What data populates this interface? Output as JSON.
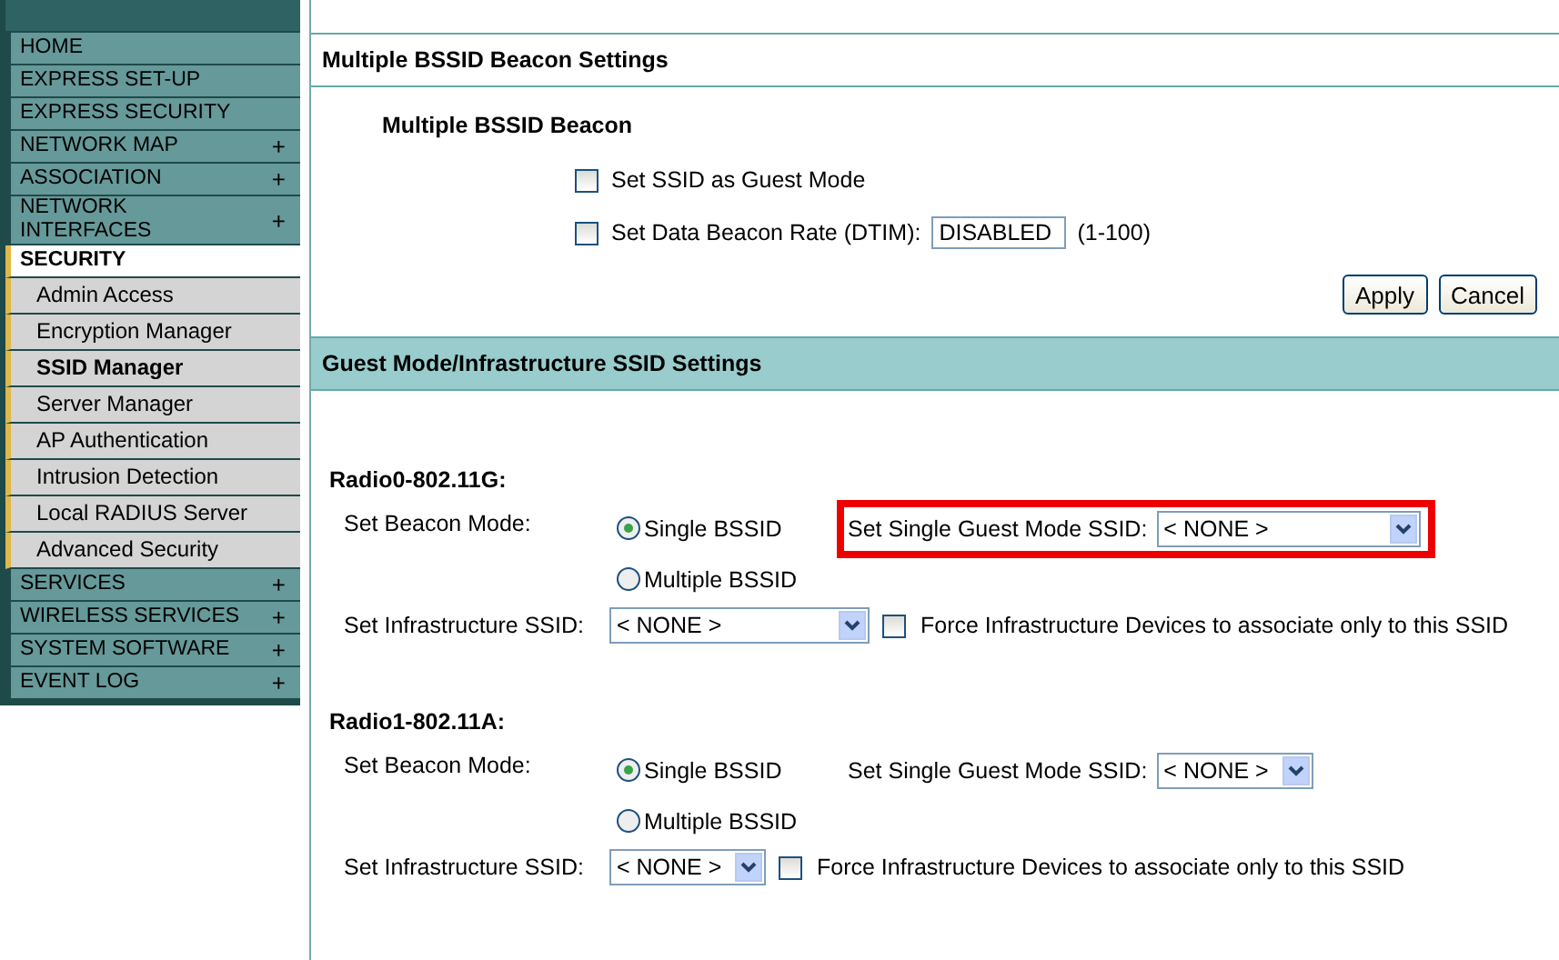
{
  "sidebar": {
    "items": [
      {
        "label": "HOME",
        "kind": "top",
        "selected": false
      },
      {
        "label": "EXPRESS SET-UP",
        "kind": "top",
        "selected": false
      },
      {
        "label": "EXPRESS SECURITY",
        "kind": "top",
        "selected": false
      },
      {
        "label": "NETWORK MAP",
        "kind": "top",
        "expand_glyph": "+",
        "selected": false
      },
      {
        "label": "ASSOCIATION",
        "kind": "top",
        "expand_glyph": "+",
        "selected": false
      },
      {
        "label": "NETWORK INTERFACES",
        "kind": "top",
        "expand_glyph": "+",
        "selected": false
      },
      {
        "label": "SECURITY",
        "kind": "top",
        "selected": true
      },
      {
        "label": "Admin Access",
        "kind": "sub",
        "selected": false
      },
      {
        "label": "Encryption Manager",
        "kind": "sub",
        "selected": false
      },
      {
        "label": "SSID Manager",
        "kind": "sub",
        "selected": true
      },
      {
        "label": "Server Manager",
        "kind": "sub",
        "selected": false
      },
      {
        "label": "AP Authentication",
        "kind": "sub",
        "selected": false
      },
      {
        "label": "Intrusion Detection",
        "kind": "sub",
        "selected": false
      },
      {
        "label": "Local RADIUS Server",
        "kind": "sub",
        "selected": false
      },
      {
        "label": "Advanced Security",
        "kind": "sub",
        "selected": false
      },
      {
        "label": "SERVICES",
        "kind": "top",
        "expand_glyph": "+",
        "selected": false
      },
      {
        "label": "WIRELESS SERVICES",
        "kind": "top",
        "expand_glyph": "+",
        "selected": false
      },
      {
        "label": "SYSTEM SOFTWARE",
        "kind": "top",
        "expand_glyph": "+",
        "selected": false
      },
      {
        "label": "EVENT LOG",
        "kind": "top",
        "expand_glyph": "+",
        "selected": false
      }
    ]
  },
  "beacon_section": {
    "title": "Multiple BSSID Beacon Settings",
    "subtitle": "Multiple BSSID Beacon",
    "guest_mode": {
      "label": "Set SSID as Guest Mode",
      "checked": false
    },
    "dtim": {
      "label": "Set Data Beacon Rate (DTIM):",
      "checked": false,
      "value": "DISABLED",
      "range": "(1-100)"
    },
    "buttons": [
      "Apply",
      "Cancel"
    ]
  },
  "guest_section": {
    "title": "Guest Mode/Infrastructure SSID Settings",
    "radios": [
      {
        "title": "Radio0-802.11G:",
        "beacon_label": "Set Beacon Mode:",
        "modes": [
          {
            "label": "Single BSSID",
            "selected": true
          },
          {
            "label": "Multiple BSSID",
            "selected": false
          }
        ],
        "guest_label": "Set Single Guest Mode SSID:",
        "guest_value": "< NONE >",
        "guest_wide": true,
        "highlighted": true,
        "infra_label": "Set Infrastructure SSID:",
        "infra_value": "< NONE >",
        "infra_wide": true,
        "force": {
          "label": "Force Infrastructure Devices to associate only to this SSID",
          "checked": false
        }
      },
      {
        "title": "Radio1-802.11A:",
        "beacon_label": "Set Beacon Mode:",
        "modes": [
          {
            "label": "Single BSSID",
            "selected": true
          },
          {
            "label": "Multiple BSSID",
            "selected": false
          }
        ],
        "guest_label": "Set Single Guest Mode SSID:",
        "guest_value": "< NONE >",
        "guest_wide": false,
        "highlighted": false,
        "infra_label": "Set Infrastructure SSID:",
        "infra_value": "< NONE >",
        "infra_wide": false,
        "force": {
          "label": "Force Infrastructure Devices to associate only to this SSID",
          "checked": false
        }
      }
    ]
  }
}
